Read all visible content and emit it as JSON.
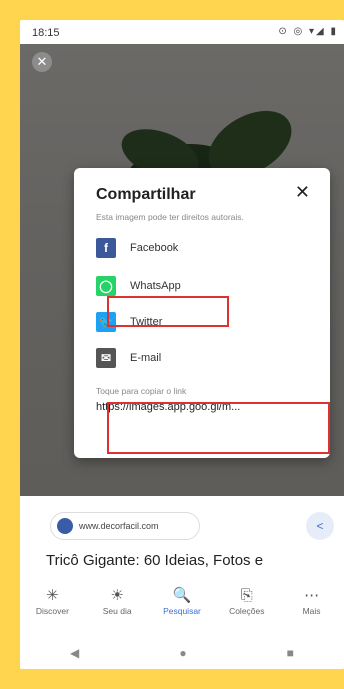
{
  "status_bar": {
    "time": "18:15",
    "icons": "⊙ ◎ ▾◢ ▮"
  },
  "viewer": {
    "close_glyph": "✕"
  },
  "dialog": {
    "title": "Compartilhar",
    "close_glyph": "✕",
    "subtitle": "Esta imagem pode ter direitos autorais.",
    "options": [
      {
        "label": "Facebook",
        "icon": "facebook-icon",
        "glyph": "f",
        "color": "#3b5998"
      },
      {
        "label": "WhatsApp",
        "icon": "whatsapp-icon",
        "glyph": "◯",
        "color": "#25d366"
      },
      {
        "label": "Twitter",
        "icon": "twitter-icon",
        "glyph": "🐦",
        "color": "#1da1f2"
      },
      {
        "label": "E-mail",
        "icon": "email-icon",
        "glyph": "✉",
        "color": "#555555"
      }
    ],
    "copy_caption": "Toque para copiar o link",
    "copy_url": "https://images.app.goo.gl/m..."
  },
  "result": {
    "source": "www.decorfacil.com",
    "title": "Tricô Gigante: 60 Ideias, Fotos e"
  },
  "bottom_nav": [
    {
      "label": "Discover",
      "icon": "asterisk-icon",
      "glyph": "✳"
    },
    {
      "label": "Seu dia",
      "icon": "sun-icon",
      "glyph": "☀"
    },
    {
      "label": "Pesquisar",
      "icon": "search-icon",
      "glyph": "🔍",
      "active": true
    },
    {
      "label": "Coleções",
      "icon": "collections-icon",
      "glyph": "⎘"
    },
    {
      "label": "Mais",
      "icon": "more-icon",
      "glyph": "⋯"
    }
  ],
  "system_nav": {
    "back": "◀",
    "home": "●",
    "recents": "■"
  },
  "colors": {
    "highlight": "#e03131",
    "accent": "#3a6fd8",
    "page_bg": "#FFD54F"
  }
}
